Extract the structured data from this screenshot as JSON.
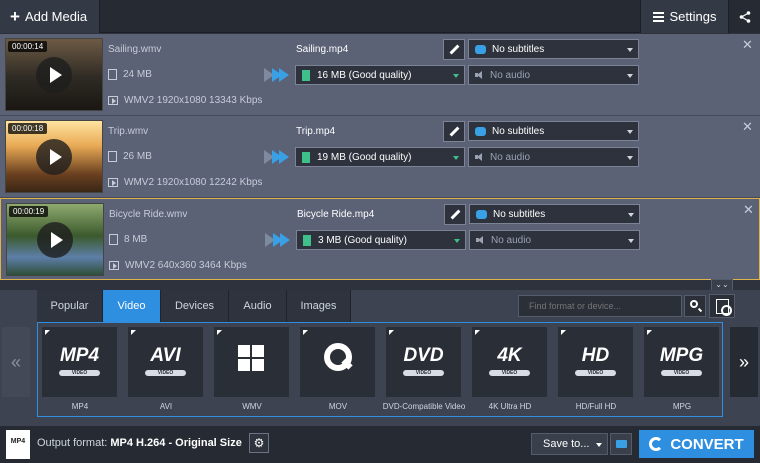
{
  "toolbar": {
    "add_media": "Add Media",
    "settings": "Settings"
  },
  "files": [
    {
      "duration": "00:00:14",
      "source_name": "Sailing.wmv",
      "source_size": "24 MB",
      "source_meta": "WMV2 1920x1080 13343 Kbps",
      "output_name": "Sailing.mp4",
      "output_quality": "16 MB (Good quality)",
      "subtitles": "No subtitles",
      "audio": "No audio",
      "selected": false
    },
    {
      "duration": "00:00:18",
      "source_name": "Trip.wmv",
      "source_size": "26 MB",
      "source_meta": "WMV2 1920x1080 12242 Kbps",
      "output_name": "Trip.mp4",
      "output_quality": "19 MB (Good quality)",
      "subtitles": "No subtitles",
      "audio": "No audio",
      "selected": false
    },
    {
      "duration": "00:00:19",
      "source_name": "Bicycle Ride.wmv",
      "source_size": "8 MB",
      "source_meta": "WMV2 640x360 3464 Kbps",
      "output_name": "Bicycle Ride.mp4",
      "output_quality": "3 MB (Good quality)",
      "subtitles": "No subtitles",
      "audio": "No audio",
      "selected": true
    }
  ],
  "format_tabs": [
    "Popular",
    "Video",
    "Devices",
    "Audio",
    "Images"
  ],
  "active_tab": "Video",
  "search": {
    "placeholder": "Find format or device..."
  },
  "formats": [
    {
      "logo": "MP4",
      "sub": "VIDEO",
      "label": "MP4"
    },
    {
      "logo": "AVI",
      "sub": "VIDEO",
      "label": "AVI"
    },
    {
      "logo": "",
      "sub": "",
      "label": "WMV"
    },
    {
      "logo": "",
      "sub": "",
      "label": "MOV"
    },
    {
      "logo": "DVD",
      "sub": "VIDEO",
      "label": "DVD-Compatible Video"
    },
    {
      "logo": "4K",
      "sub": "VIDEO",
      "label": "4K Ultra HD"
    },
    {
      "logo": "HD",
      "sub": "VIDEO",
      "label": "HD/Full HD"
    },
    {
      "logo": "MPG",
      "sub": "VIDEO",
      "label": "MPG"
    }
  ],
  "bottom": {
    "output_icon": "MP4",
    "output_label": "Output format:",
    "output_value": "MP4 H.264 - Original Size",
    "save_to": "Save to...",
    "convert": "CONVERT"
  },
  "colors": {
    "accent": "#2e8fe0",
    "selected_border": "#e0b24a",
    "row_bg": "#5b6276",
    "quality_icon": "#3fbf8a"
  },
  "icons": [
    "plus-icon",
    "menu-icon",
    "share-icon",
    "play-icon",
    "file-icon",
    "video-icon",
    "edit-icon",
    "subtitle-icon",
    "audio-icon",
    "close-icon",
    "search-icon",
    "detect-device-icon",
    "gear-icon",
    "folder-icon",
    "convert-icon"
  ]
}
